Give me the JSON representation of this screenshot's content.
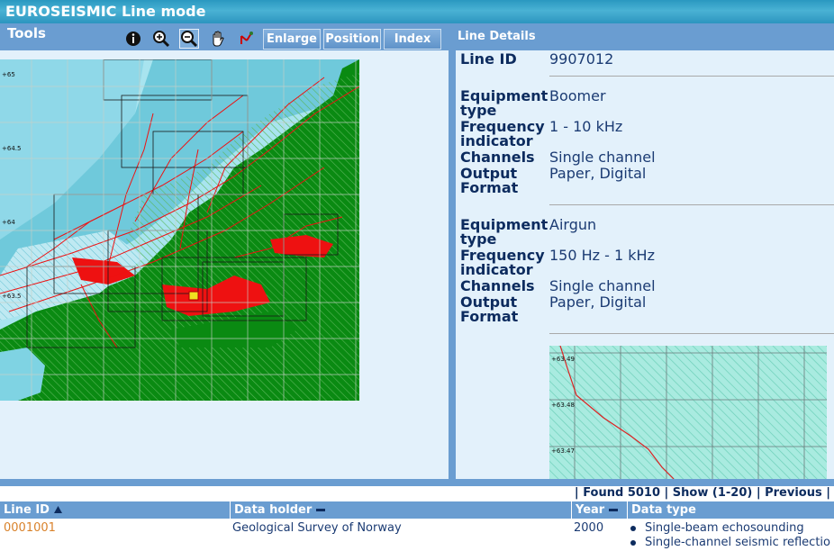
{
  "app": {
    "title": "EUROSEISMIC Line mode"
  },
  "toolbar": {
    "label": "Tools",
    "icons": [
      "info-icon",
      "zoom-in-icon",
      "zoom-out-icon",
      "pan-hand-icon",
      "measure-icon"
    ],
    "buttons": {
      "enlarge": "Enlarge",
      "position": "Position",
      "index": "Index"
    }
  },
  "map": {
    "lat_labels": [
      "+65",
      "+64.5",
      "+64",
      "+63.5"
    ]
  },
  "details": {
    "header": "Line Details",
    "line_id_label": "Line ID",
    "line_id_value": "9907012",
    "equipment": [
      {
        "equipment_label": "Equipment type",
        "equipment_value": "Boomer",
        "frequency_label": "Frequency indicator",
        "frequency_value": "1 - 10 kHz",
        "channels_label": "Channels",
        "channels_value": "Single channel",
        "output_label": "Output Format",
        "output_value": "Paper, Digital"
      },
      {
        "equipment_label": "Equipment type",
        "equipment_value": "Airgun",
        "frequency_label": "Frequency indicator",
        "frequency_value": "150 Hz - 1 kHz",
        "channels_label": "Channels",
        "channels_value": "Single channel",
        "output_label": "Output Format",
        "output_value": "Paper, Digital"
      }
    ],
    "minimap_labels": [
      "+63.49",
      "+63.48",
      "+63.47"
    ]
  },
  "results": {
    "found_bar": "| Found 5010 | Show  (1-20) | Previous |",
    "columns": [
      "Line ID",
      "Data holder",
      "Year",
      "Data type"
    ],
    "rows": [
      {
        "line_id": "0001001",
        "data_holder": "Geological Survey of Norway",
        "year": "2000",
        "data_types": [
          "Single-beam echosounding",
          "Single-channel seismic reflectio"
        ]
      }
    ]
  },
  "colors": {
    "header_blue": "#6a9dd1",
    "panel_bg": "#e3f1fb",
    "land": "#0a8a12",
    "sea": "#7fd3e3",
    "lines": "#ee1111",
    "link": "#d9822b"
  }
}
